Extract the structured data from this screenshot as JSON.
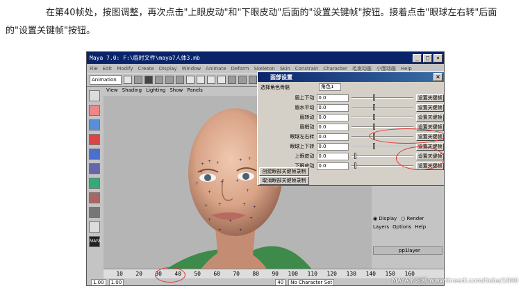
{
  "instruction": "在第40帧处，按图调整，再次点击\"上眼皮动\"和\"下眼皮动\"后面的\"设置关键帧\"按钮。接着点击\"眼球左右转\"后面的\"设置关键帧\"按钮。",
  "maya": {
    "title": "Maya 7.0: F:\\临时文件\\maya7人体3.mb",
    "menus": [
      "File",
      "Edit",
      "Modify",
      "Create",
      "Display",
      "Window",
      "Animate",
      "Deform",
      "Skeleton",
      "Skin",
      "Constrain",
      "Character",
      "毛发动画",
      "小面动画",
      "Help"
    ],
    "mode": "Animation",
    "viewport_menus": [
      "View",
      "Shading",
      "Lighting",
      "Show",
      "Panels"
    ],
    "timeline_ticks": [
      "10",
      "20",
      "30",
      "40",
      "50",
      "60",
      "70",
      "80",
      "90",
      "100",
      "110",
      "120",
      "130",
      "140",
      "150",
      "160"
    ],
    "current_frame": "40",
    "range_start": "1.00",
    "range_end": "1.00",
    "character_set": "No Character Set",
    "layers": {
      "display_label": "Display",
      "render_label": "Render",
      "menus": [
        "Layers",
        "Options",
        "Help"
      ],
      "layer_name": "pp1layer"
    },
    "logo": "MAYA"
  },
  "dialog": {
    "title": "面部设置",
    "select_label": "选择角色骨骼",
    "select_value": "角色1",
    "rows": [
      {
        "label": "眉上下动",
        "value": "0.0",
        "slider": 0.35,
        "button": "设置关键帧"
      },
      {
        "label": "眉水平动",
        "value": "0.0",
        "slider": 0.35,
        "button": "设置关键帧"
      },
      {
        "label": "眉转动",
        "value": "0.0",
        "slider": 0.35,
        "button": "设置关键帧"
      },
      {
        "label": "眉梢动",
        "value": "0.0",
        "slider": 0.35,
        "button": "设置关键帧"
      },
      {
        "label": "眼球左右转",
        "value": "0.0",
        "slider": 0.35,
        "button": "设置关键帧"
      },
      {
        "label": "眼球上下转",
        "value": "0.0",
        "slider": 0.35,
        "button": "设置关键帧"
      },
      {
        "label": "上眼皮动",
        "value": "0.0",
        "slider": 0.05,
        "button": "设置关键帧"
      },
      {
        "label": "下眼皮动",
        "value": "0.0",
        "slider": 0.05,
        "button": "设置关键帧"
      }
    ],
    "create_btn": "创建眼部关键帧录制",
    "cancel_btn": "取消眼部关键帧录制"
  },
  "watermark": "MAYA学习网 www.lineedi.com/tieba/1800"
}
